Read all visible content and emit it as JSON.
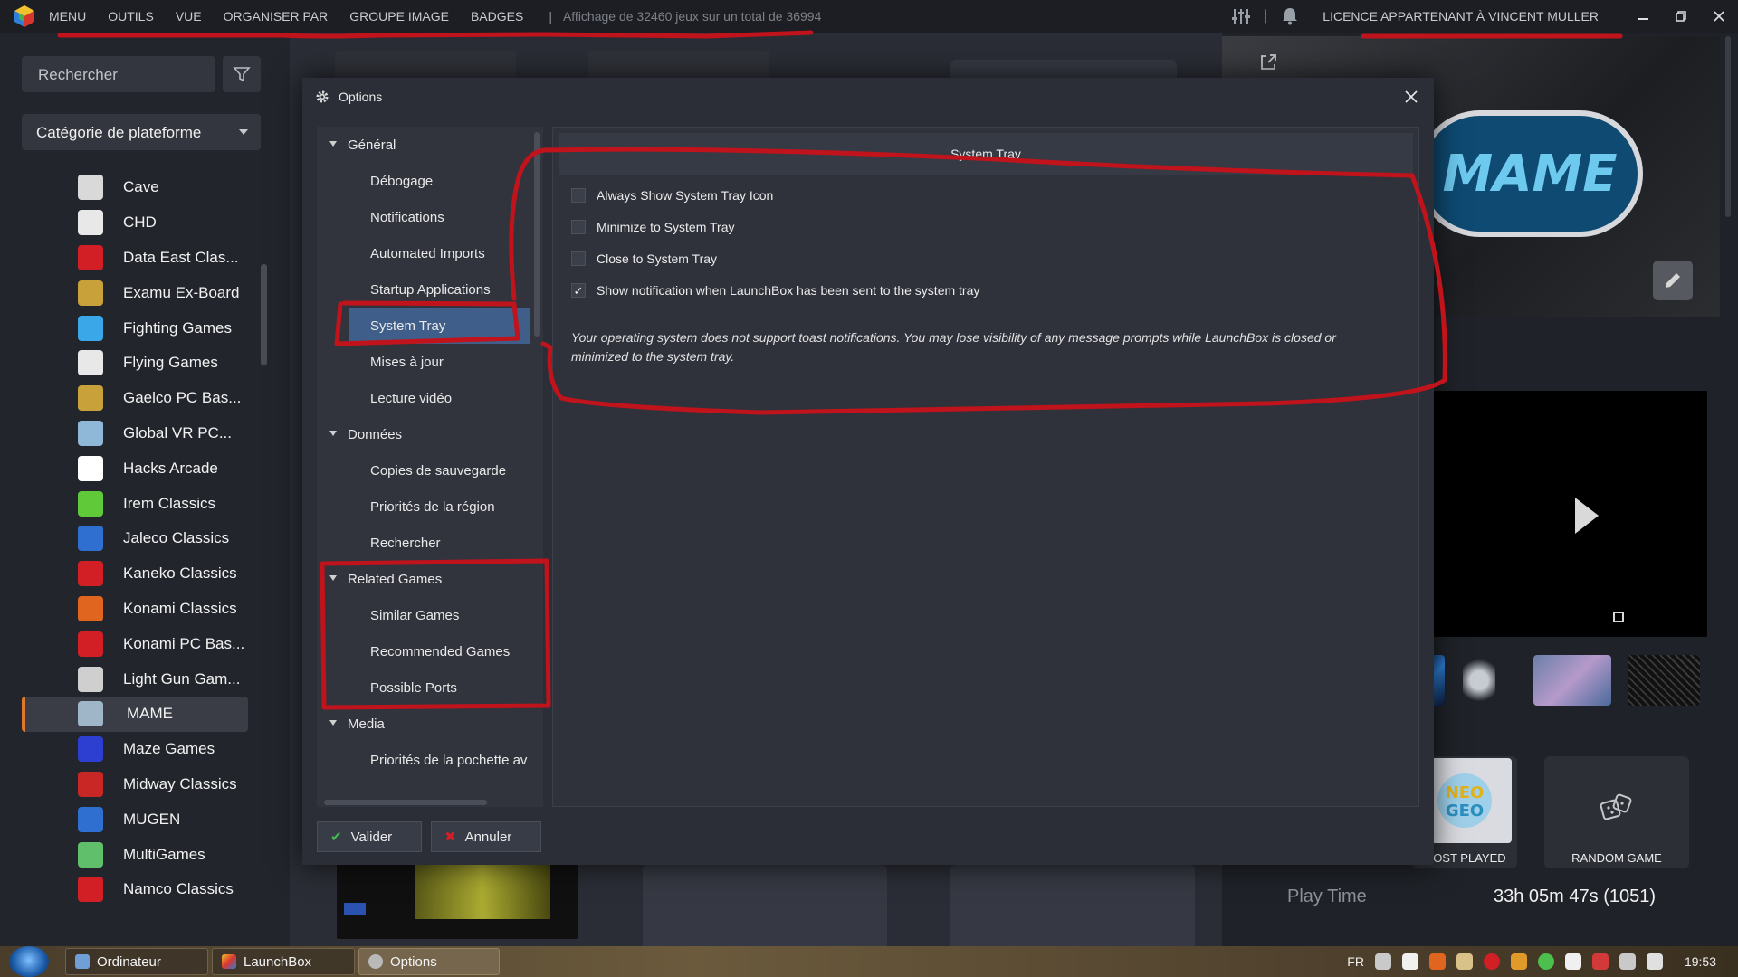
{
  "topbar": {
    "menus": [
      "MENU",
      "OUTILS",
      "VUE",
      "ORGANISER PAR",
      "GROUPE IMAGE",
      "BADGES"
    ],
    "separator": "|",
    "count_label": "Affichage de 32460 jeux sur un total de 36994",
    "license": "LICENCE APPARTENANT À VINCENT MULLER"
  },
  "sidebar": {
    "search_placeholder": "Rechercher",
    "category": "Catégorie de plateforme",
    "platforms": [
      {
        "label": "Cave",
        "icon": "cave-icon",
        "color": "#d9d9d9"
      },
      {
        "label": "CHD",
        "icon": "disc-icon",
        "color": "#e8e8e8"
      },
      {
        "label": "Data East Clas...",
        "icon": "data-east-icon",
        "color": "#d21f26"
      },
      {
        "label": "Examu Ex-Board",
        "icon": "arcade-cabinet-icon",
        "color": "#c9a13a"
      },
      {
        "label": "Fighting Games",
        "icon": "fighting-icon",
        "color": "#3aa7e8"
      },
      {
        "label": "Flying Games",
        "icon": "plane-icon",
        "color": "#e8e8e8"
      },
      {
        "label": "Gaelco PC Bas...",
        "icon": "arcade-cabinet-icon",
        "color": "#c9a13a"
      },
      {
        "label": "Global VR PC...",
        "icon": "globe-icon",
        "color": "#8fb7d8"
      },
      {
        "label": "Hacks Arcade",
        "icon": "hacked-icon",
        "color": "#ffffff"
      },
      {
        "label": "Irem Classics",
        "icon": "irem-icon",
        "color": "#5fc93a"
      },
      {
        "label": "Jaleco Classics",
        "icon": "jaleco-icon",
        "color": "#2f6fd0"
      },
      {
        "label": "Kaneko Classics",
        "icon": "kaneko-icon",
        "color": "#d21f26"
      },
      {
        "label": "Konami Classics",
        "icon": "konami-icon",
        "color": "#e0661f"
      },
      {
        "label": "Konami PC Bas...",
        "icon": "konami-logo-icon",
        "color": "#d21f26"
      },
      {
        "label": "Light Gun Gam...",
        "icon": "light-gun-icon",
        "color": "#cfcfcf"
      },
      {
        "label": "MAME",
        "icon": "mame-icon",
        "color": "#9fb6c9"
      },
      {
        "label": "Maze Games",
        "icon": "maze-icon",
        "color": "#2d3fd0"
      },
      {
        "label": "Midway Classics",
        "icon": "midway-icon",
        "color": "#c92626"
      },
      {
        "label": "MUGEN",
        "icon": "mugen-icon",
        "color": "#2f6fd0"
      },
      {
        "label": "MultiGames",
        "icon": "multigames-icon",
        "color": "#5fbf6a"
      },
      {
        "label": "Namco Classics",
        "icon": "namco-icon",
        "color": "#d21f26"
      }
    ],
    "active_platform": "MAME"
  },
  "dialog": {
    "title": "Options",
    "close_icon": "close-icon",
    "tree": [
      {
        "type": "cat",
        "label": "Général"
      },
      {
        "type": "leaf",
        "label": "Débogage"
      },
      {
        "type": "leaf",
        "label": "Notifications"
      },
      {
        "type": "leaf",
        "label": "Automated Imports"
      },
      {
        "type": "leaf",
        "label": "Startup Applications"
      },
      {
        "type": "sel",
        "label": "System Tray"
      },
      {
        "type": "leaf",
        "label": "Mises à jour"
      },
      {
        "type": "leaf",
        "label": "Lecture vidéo"
      },
      {
        "type": "cat",
        "label": "Données"
      },
      {
        "type": "leaf",
        "label": "Copies de sauvegarde"
      },
      {
        "type": "leaf",
        "label": "Priorités de la région"
      },
      {
        "type": "leaf",
        "label": "Rechercher"
      },
      {
        "type": "cat",
        "label": "Related Games"
      },
      {
        "type": "leaf",
        "label": "Similar Games"
      },
      {
        "type": "leaf",
        "label": "Recommended Games"
      },
      {
        "type": "leaf",
        "label": "Possible Ports"
      },
      {
        "type": "cat",
        "label": "Media"
      },
      {
        "type": "leaf",
        "label": "Priorités de la pochette av"
      }
    ],
    "panel_title": "System Tray",
    "options": [
      {
        "label": "Always Show System Tray Icon",
        "checked": false
      },
      {
        "label": "Minimize to System Tray",
        "checked": false
      },
      {
        "label": "Close to System Tray",
        "checked": false
      },
      {
        "label": "Show notification when LaunchBox has been sent to the system tray",
        "checked": true
      }
    ],
    "note": "Your operating system does not support toast notifications. You may lose visibility of any message prompts while LaunchBox is closed or minimized to the system tray.",
    "ok_label": "Valider",
    "cancel_label": "Annuler"
  },
  "details": {
    "most_played_label": "MOST PLAYED",
    "random_game_label": "RANDOM GAME",
    "play_time_label": "Play Time",
    "play_time_value": "33h 05m 47s (1051)"
  },
  "taskbar": {
    "tasks": [
      "Ordinateur",
      "LaunchBox",
      "Options"
    ],
    "lang": "FR",
    "clock": "19:53"
  },
  "colors": {
    "accent_selection": "#3f5f8a",
    "active_marker": "#e07a2b",
    "annotation_red": "#c0131b",
    "check_ok": "#3fb950",
    "cancel_x": "#d21f26"
  }
}
